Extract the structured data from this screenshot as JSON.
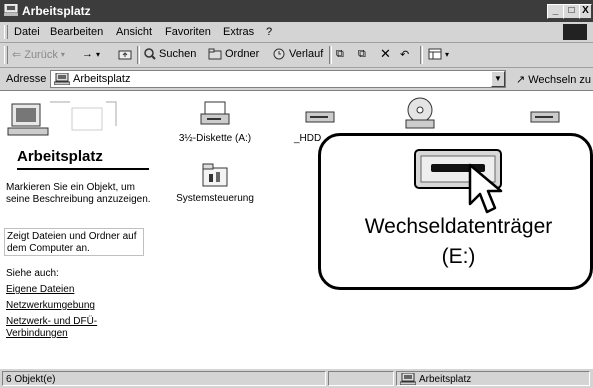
{
  "window": {
    "title": "Arbeitsplatz",
    "buttons": [
      "_",
      "□",
      "X"
    ]
  },
  "menubar": [
    "Datei",
    "Bearbeiten",
    "Ansicht",
    "Favoriten",
    "Extras",
    "?"
  ],
  "toolbar": {
    "back": "Zurück",
    "forward": "→",
    "search": "Suchen",
    "folders": "Ordner",
    "history": "Verlauf"
  },
  "address": {
    "label": "Adresse",
    "value": "Arbeitsplatz",
    "go": "Wechseln zu"
  },
  "leftpanel": {
    "title": "Arbeitsplatz",
    "description": "Markieren Sie ein Objekt, um seine Beschreibung anzuzeigen.",
    "info": "Zeigt Dateien und Ordner auf dem Computer an.",
    "see_also": "Siehe auch:",
    "links": [
      "Eigene Dateien",
      "Netzwerkumgebung",
      "Netzwerk- und DFÜ-Verbindungen"
    ]
  },
  "items": [
    {
      "label": "3½-Diskette (A:)",
      "icon": "floppy-drive-icon"
    },
    {
      "label": "_HDD",
      "icon": "hard-drive-icon"
    },
    {
      "label": "",
      "icon": "cd-drive-icon"
    },
    {
      "label": "",
      "icon": "removable-drive-icon"
    },
    {
      "label": "Systemsteuerung",
      "icon": "control-panel-icon"
    }
  ],
  "callout": {
    "label_line1": "Wechseldatenträger",
    "label_line2": "(E:)"
  },
  "statusbar": {
    "count": "6 Objekt(e)",
    "location": "Arbeitsplatz"
  }
}
